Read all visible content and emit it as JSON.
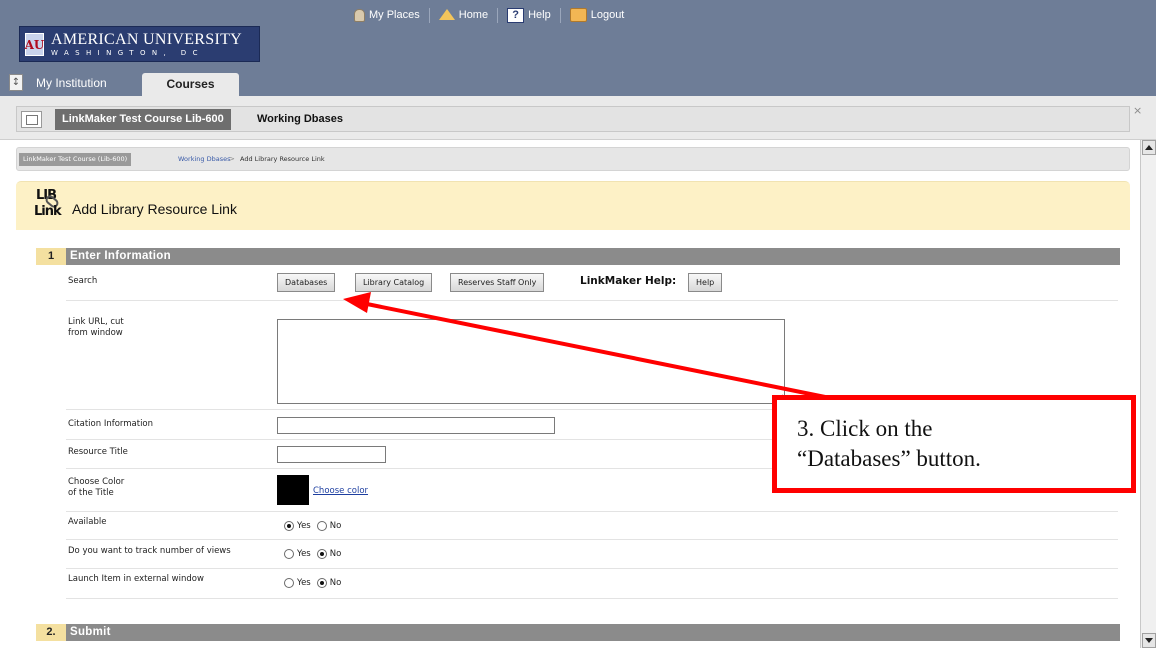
{
  "banner": {
    "university_name": "AMERICAN UNIVERSITY",
    "university_city": "WASHINGTON, DC",
    "logo_mark": "AU",
    "top_nav": [
      {
        "label": "My Places",
        "icon": "person-icon"
      },
      {
        "label": "Home",
        "icon": "home-icon"
      },
      {
        "label": "Help",
        "icon": "help-icon"
      },
      {
        "label": "Logout",
        "icon": "logout-icon"
      }
    ],
    "tabs": [
      {
        "label": "My Institution",
        "active": false
      },
      {
        "label": "Courses",
        "active": true
      }
    ],
    "toggle_glyph": "↕"
  },
  "course_bar": {
    "course_name": "LinkMaker Test Course Lib-600",
    "page_name": "Working Dbases",
    "close_glyph": "×"
  },
  "breadcrumb": {
    "course": "LinkMaker Test Course (Lib-600)",
    "section": "Working Dbases",
    "separator": ">",
    "current": "Add Library Resource Link"
  },
  "page": {
    "icon_line1": "LIB",
    "icon_line2": "Link",
    "title": "Add Library Resource Link"
  },
  "sections": [
    {
      "number": "1",
      "title": "Enter Information"
    },
    {
      "number": "2.",
      "title": "Submit"
    }
  ],
  "form": {
    "search": {
      "label": "Search",
      "buttons": [
        "Databases",
        "Library Catalog",
        "Reserves Staff Only"
      ],
      "help_label": "LinkMaker Help:",
      "help_button": "Help"
    },
    "link_url": {
      "label": "Link URL, cut\nfrom window",
      "value": ""
    },
    "citation": {
      "label": "Citation Information",
      "value": ""
    },
    "resource_title": {
      "label": "Resource Title",
      "value": ""
    },
    "choose_color": {
      "label": "Choose Color\nof the Title",
      "link": "Choose color",
      "swatch_color": "#000000"
    },
    "available": {
      "label": "Available",
      "yes": "Yes",
      "no": "No",
      "selected": "Yes"
    },
    "track_views": {
      "label": "Do you want to track number of views",
      "yes": "Yes",
      "no": "No",
      "selected": "No"
    },
    "external_window": {
      "label": "Launch Item in external window",
      "yes": "Yes",
      "no": "No",
      "selected": "No"
    }
  },
  "annotation": {
    "line1": "3. Click on the",
    "line2": "“Databases” button.",
    "color": "#ff0000"
  },
  "colors": {
    "banner": "#6e7d97",
    "logo_bg": "#2b3d71",
    "header_bg": "#fdf1c6",
    "section_bar": "#8b8b8b",
    "section_num_bg": "#f4e0a0"
  }
}
